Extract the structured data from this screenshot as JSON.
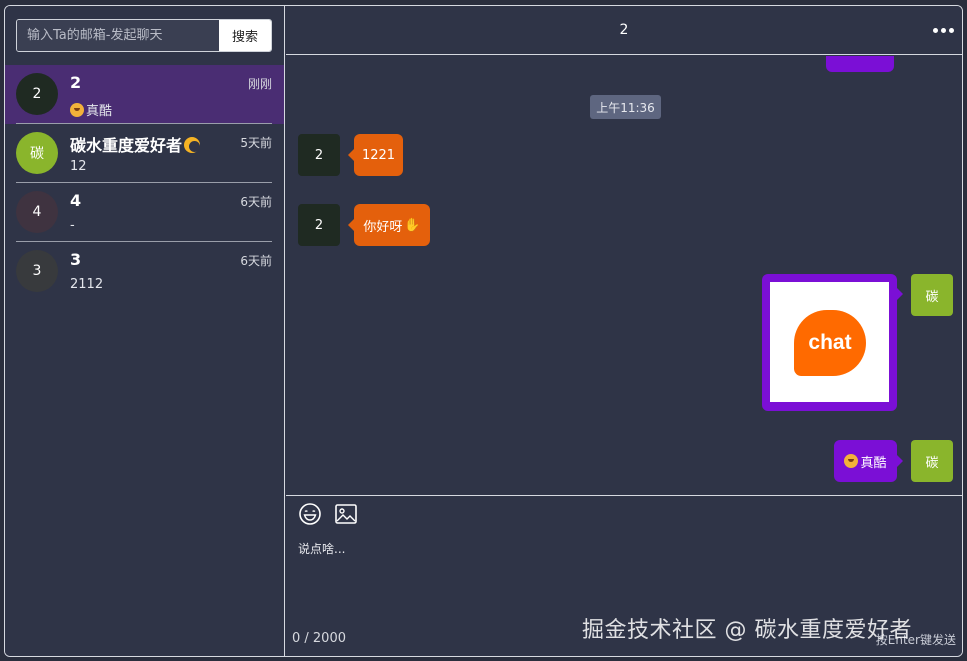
{
  "search": {
    "placeholder": "输入Ta的邮箱-发起聊天",
    "button_label": "搜索"
  },
  "conversations": [
    {
      "avatar": "2",
      "name": "2",
      "preview": "真酷",
      "time": "刚刚",
      "active": true,
      "avatar_color": "#1f2a22"
    },
    {
      "avatar": "碳",
      "name": "碳水重度爱好者",
      "preview": "12",
      "time": "5天前",
      "active": false,
      "avatar_color": "#8ab52c"
    },
    {
      "avatar": "4",
      "name": "4",
      "preview": "-",
      "time": "6天前",
      "active": false,
      "avatar_color": "#3f3340"
    },
    {
      "avatar": "3",
      "name": "3",
      "preview": "2112",
      "time": "6天前",
      "active": false,
      "avatar_color": "#383a3d"
    }
  ],
  "chat": {
    "title": "2",
    "timestamp": "上午11:36",
    "messages": [
      {
        "from": "other",
        "avatar": "2",
        "text": "1221"
      },
      {
        "from": "other",
        "avatar": "2",
        "text": "你好呀"
      },
      {
        "from": "me",
        "avatar": "碳",
        "type": "image",
        "image_text": "chat"
      },
      {
        "from": "me",
        "avatar": "碳",
        "text": "真酷"
      }
    ]
  },
  "composer": {
    "placeholder": "说点啥...",
    "counter": "0 / 2000",
    "hint": "按Enter键发送"
  },
  "watermark": "掘金技术社区 @ 碳水重度爱好者",
  "colors": {
    "accent_purple": "#7b0fd6",
    "other_bubble": "#e4600c",
    "active_conv": "#4a2d73",
    "my_avatar": "#8ab52c"
  }
}
